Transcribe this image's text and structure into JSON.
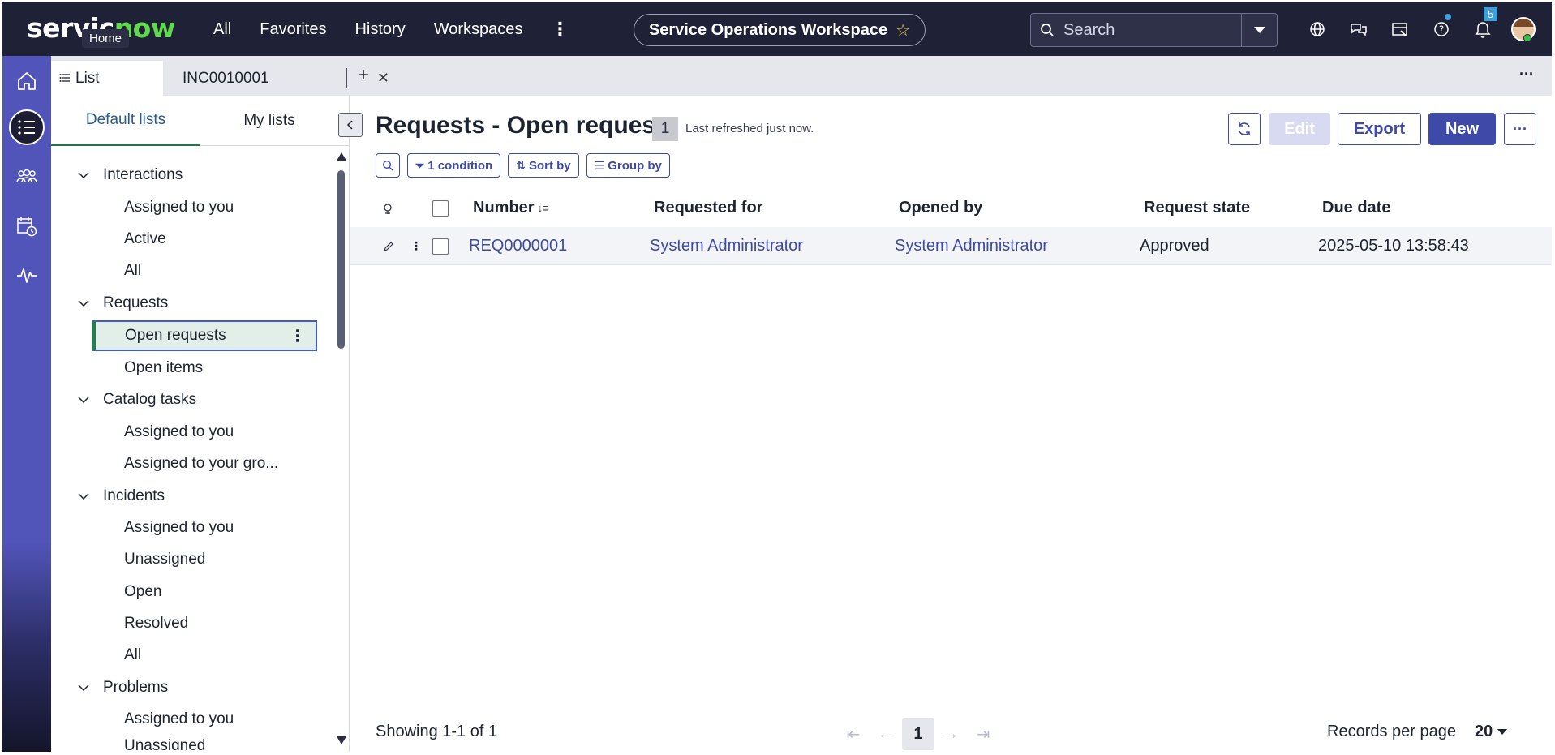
{
  "header": {
    "logo_text_a": "servic",
    "logo_text_b": "now",
    "home_tooltip": "Home",
    "nav": [
      "All",
      "Favorites",
      "History",
      "Workspaces"
    ],
    "workspace_title": "Service Operations Workspace",
    "search_placeholder": "Search",
    "notification_count": "5",
    "icons": [
      "globe-icon",
      "chat-icon",
      "inbox-icon",
      "help-icon",
      "bell-icon"
    ]
  },
  "tabs": {
    "list_label": "List",
    "incident_label": "INC0010001"
  },
  "sidepanel": {
    "tab_default": "Default lists",
    "tab_mine": "My lists",
    "groups": [
      {
        "label": "Interactions",
        "items": [
          "Assigned to you",
          "Active",
          "All"
        ]
      },
      {
        "label": "Requests",
        "items": [
          "Open requests",
          "Open items"
        ]
      },
      {
        "label": "Catalog tasks",
        "items": [
          "Assigned to you",
          "Assigned to your gro..."
        ]
      },
      {
        "label": "Incidents",
        "items": [
          "Assigned to you",
          "Unassigned",
          "Open",
          "Resolved",
          "All"
        ]
      },
      {
        "label": "Problems",
        "items": [
          "Assigned to you",
          "Unassigned"
        ]
      }
    ]
  },
  "main": {
    "title": "Requests - Open requests",
    "count": "1",
    "refreshed": "Last refreshed just now.",
    "buttons": {
      "edit": "Edit",
      "export": "Export",
      "new": "New"
    },
    "filters": {
      "condition": "1 condition",
      "sort": "Sort by",
      "group": "Group by"
    },
    "columns": [
      "Number",
      "Requested for",
      "Opened by",
      "Request state",
      "Due date"
    ],
    "rows": [
      {
        "number": "REQ0000001",
        "requested_for": "System Administrator",
        "opened_by": "System Administrator",
        "state": "Approved",
        "due": "2025-05-10 13:58:43"
      }
    ],
    "showing": "Showing 1-1 of 1",
    "current_page": "1",
    "records_per_page_label": "Records per page",
    "records_per_page": "20"
  },
  "colors": {
    "header_bg": "#1f2236",
    "rail_bg": "#5154b8",
    "accent": "#3d4aa8",
    "brand_green": "#62d84e"
  }
}
